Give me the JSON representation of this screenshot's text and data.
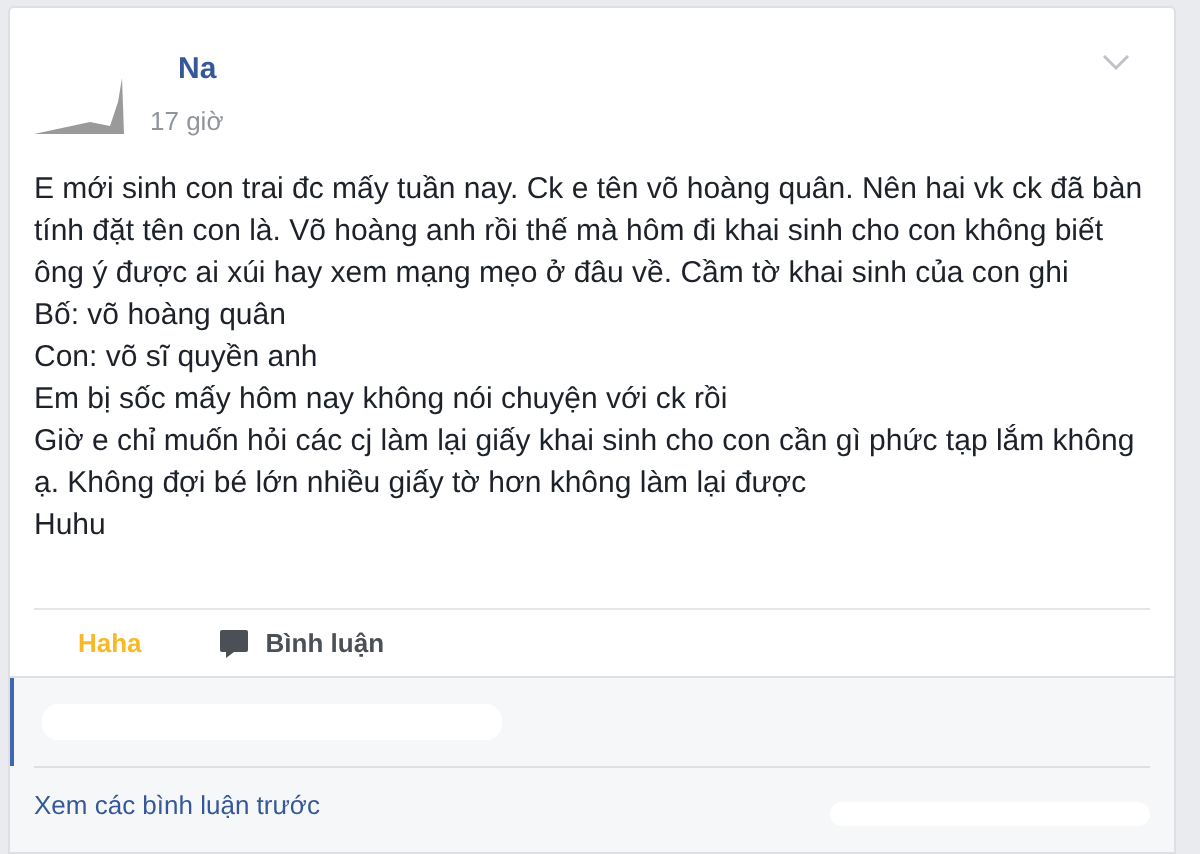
{
  "post": {
    "author": "Na",
    "time": "17 giờ",
    "paragraphs": [
      "E mới sinh con trai đc mấy tuần nay. Ck e tên võ hoàng quân. Nên hai vk ck đã bàn tính đặt tên con là. Võ hoàng anh rồi thế mà hôm đi khai sinh cho con không biết ông ý được ai xúi hay xem mạng mẹo ở đâu về. Cầm tờ khai sinh của con ghi",
      "Bố: võ hoàng quân",
      "Con: võ sĩ quyền anh",
      "Em bị sốc mấy hôm nay không nói chuyện với ck rồi",
      "Giờ e chỉ muốn hỏi các cj làm lại giấy khai sinh cho con cần gì phức tạp lắm không ạ. Không đợi bé lớn nhiều giấy tờ hơn không làm lại được",
      "Huhu"
    ]
  },
  "actions": [
    {
      "kind": "reaction",
      "label": "Haha"
    },
    {
      "kind": "comment",
      "label": "Bình luận"
    }
  ],
  "comments": {
    "more_link": "Xem các bình luận trước"
  }
}
